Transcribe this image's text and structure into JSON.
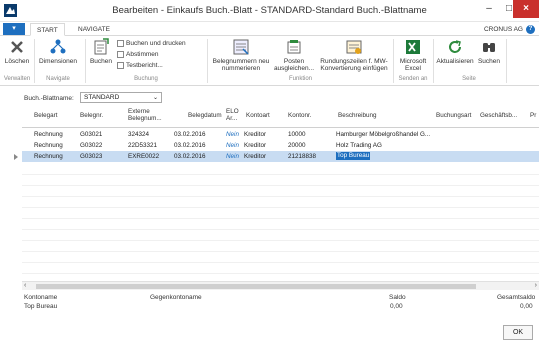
{
  "window": {
    "title": "Bearbeiten - Einkaufs Buch.-Blatt - STANDARD-Standard Buch.-Blattname",
    "min": "–",
    "max": "□",
    "close": "×"
  },
  "ribbon_tabs": {
    "file": "▾",
    "start": "START",
    "navigate": "NAVIGATE",
    "company": "CRONUS AG",
    "help": "?"
  },
  "ribbon": {
    "delete": "Löschen",
    "dimensions": "Dimensionen",
    "post": "Buchen",
    "post_print": "Buchen und drucken",
    "reconcile": "Abstimmen",
    "test_report": "Testbericht...",
    "renumber": "Belegnummern neu nummerieren",
    "apply_entries": "Posten ausgleichen...",
    "rounding_vat": "Rundungszeilen f. MW-Konvertierung einfügen",
    "excel": "Microsoft Excel",
    "refresh": "Aktualisieren",
    "find": "Suchen",
    "groups": {
      "manage": "Verwalten",
      "navigate": "Navigate",
      "posting": "Buchung",
      "function": "Funktion",
      "send": "Senden an",
      "page": "Seite"
    }
  },
  "journal": {
    "label": "Buch.-Blattname:",
    "value": "STANDARD",
    "chevron": "⌄"
  },
  "grid": {
    "headers": {
      "doc_type": "Belegart",
      "doc_no": "Belegnr.",
      "ext_doc_no": "Externe Belegnum...",
      "doc_date": "Belegdatum",
      "elo": "ELO Ar...",
      "account_type": "Kontoart",
      "account_no": "Kontonr.",
      "description": "Beschreibung",
      "posting_type": "Buchungsart",
      "business": "Geschäftsb...",
      "more": "Pr"
    },
    "rows": [
      {
        "doc_type": "Rechnung",
        "doc_no": "G03021",
        "ext_doc_no": "324324",
        "doc_date": "03.02.2016",
        "elo": "Nein",
        "account_type": "Kreditor",
        "account_no": "10000",
        "description": "Hamburger Möbelgroßhandel G..."
      },
      {
        "doc_type": "Rechnung",
        "doc_no": "G03022",
        "ext_doc_no": "22D53321",
        "doc_date": "03.02.2016",
        "elo": "Nein",
        "account_type": "Kreditor",
        "account_no": "20000",
        "description": "Holz Trading AG"
      },
      {
        "doc_type": "Rechnung",
        "doc_no": "G03023",
        "ext_doc_no": "EXRE0022",
        "doc_date": "03.02.2016",
        "elo": "Nein",
        "account_type": "Kreditor",
        "account_no": "21218838",
        "description": "Top Bureau"
      }
    ]
  },
  "scroll": {
    "left": "‹",
    "right": "›"
  },
  "footer": {
    "account_name_label": "Kontoname",
    "account_name_value": "Top Bureau",
    "bal_account_label": "Gegenkontoname",
    "balance_label": "Saldo",
    "balance_value": "0,00",
    "total_label": "Gesamtsaldo",
    "total_value": "0,00",
    "ok": "OK"
  },
  "colors": {
    "accent": "#1e6fbf",
    "selection": "#c8dcf2",
    "close": "#c9302c"
  }
}
